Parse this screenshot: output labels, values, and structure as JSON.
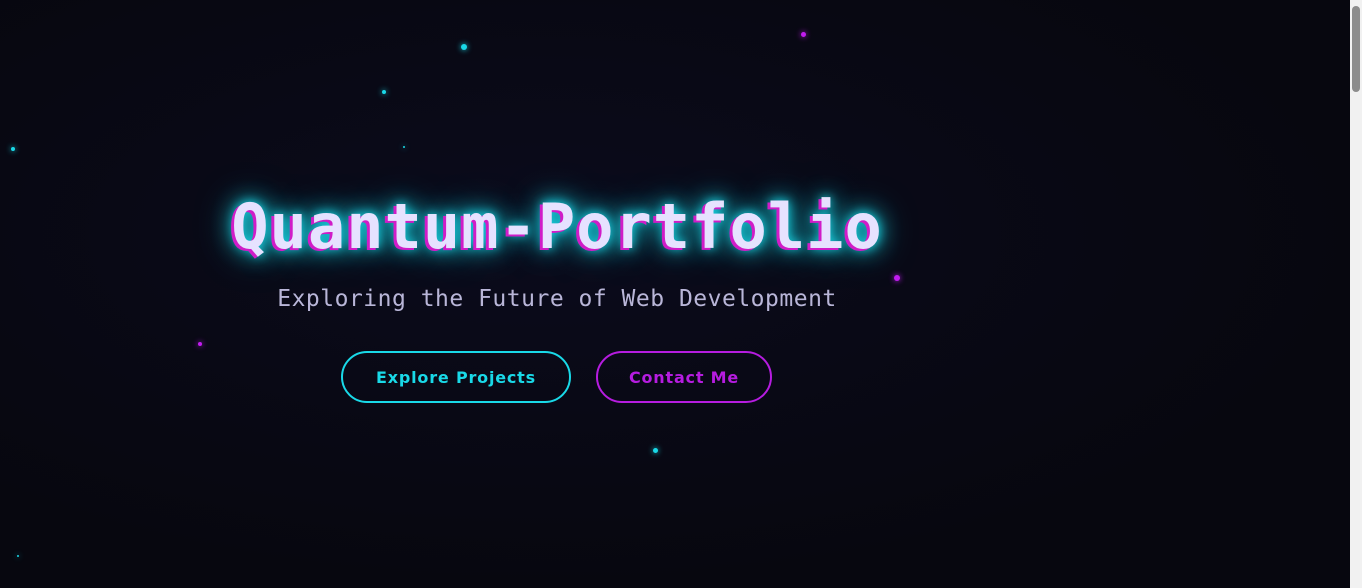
{
  "hero": {
    "title": "Quantum-Portfolio",
    "subtitle": "Exploring the Future of Web Development"
  },
  "actions": {
    "explore_label": "Explore Projects",
    "contact_label": "Contact Me"
  },
  "colors": {
    "background": "#07070f",
    "accent_cyan": "#19d9e8",
    "accent_magenta": "#b61ce0",
    "title_text": "#e6e2ff",
    "subtitle_text": "#b9b6d8"
  }
}
